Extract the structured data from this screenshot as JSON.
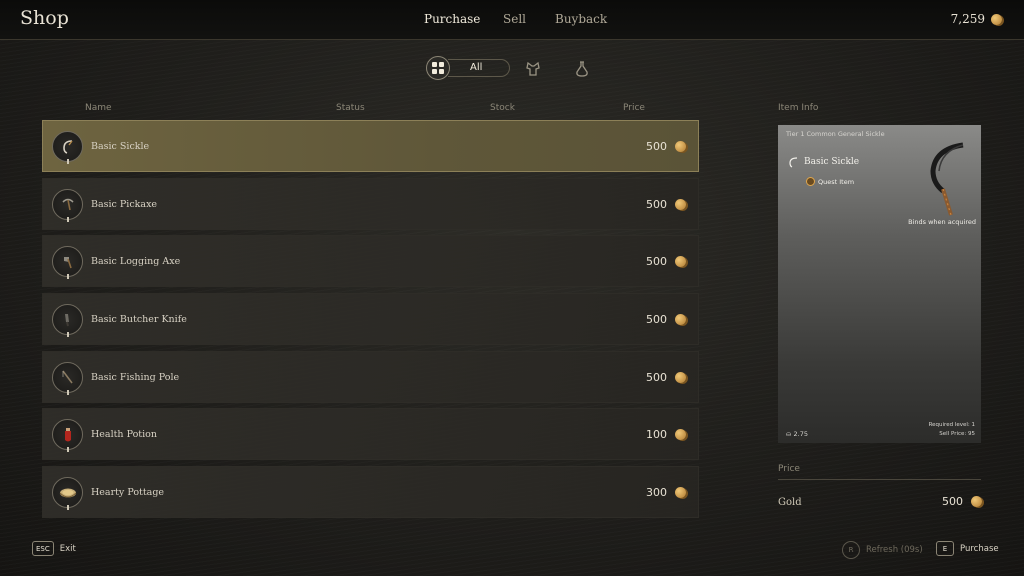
{
  "header": {
    "title": "Shop",
    "tabs": [
      "Purchase",
      "Sell",
      "Buyback"
    ],
    "gold": "7,259"
  },
  "filters": {
    "all_label": "All",
    "icons": [
      "grid-icon",
      "armor-icon",
      "potion-icon"
    ]
  },
  "columns": {
    "name": "Name",
    "status": "Status",
    "stock": "Stock",
    "price": "Price"
  },
  "items": [
    {
      "name": "Basic Sickle",
      "price": "500",
      "icon": "sickle-icon"
    },
    {
      "name": "Basic Pickaxe",
      "price": "500",
      "icon": "pickaxe-icon"
    },
    {
      "name": "Basic Logging Axe",
      "price": "500",
      "icon": "axe-icon"
    },
    {
      "name": "Basic Butcher Knife",
      "price": "500",
      "icon": "knife-icon"
    },
    {
      "name": "Basic Fishing Pole",
      "price": "500",
      "icon": "fishing-pole-icon"
    },
    {
      "name": "Health Potion",
      "price": "100",
      "icon": "potion-icon"
    },
    {
      "name": "Hearty Pottage",
      "price": "300",
      "icon": "bowl-icon"
    }
  ],
  "item_info": {
    "header": "Item Info",
    "tier_line": "Tier 1  Common  General  Sickle",
    "name": "Basic Sickle",
    "tag": "Quest Item",
    "binds": "Binds when acquired",
    "weight": "2.75",
    "required_level": "Required level: 1",
    "sell_price": "Sell Price: 95"
  },
  "price_panel": {
    "header": "Price",
    "currency": "Gold",
    "value": "500"
  },
  "footer": {
    "exit_key": "ESC",
    "exit_label": "Exit",
    "refresh_key": "R",
    "refresh_label": "Refresh (09s)",
    "purchase_key": "E",
    "purchase_label": "Purchase"
  },
  "colors": {
    "selected_row": "#6e6440",
    "gold_coin": "#d9a451",
    "background": "#1f1e1b"
  }
}
